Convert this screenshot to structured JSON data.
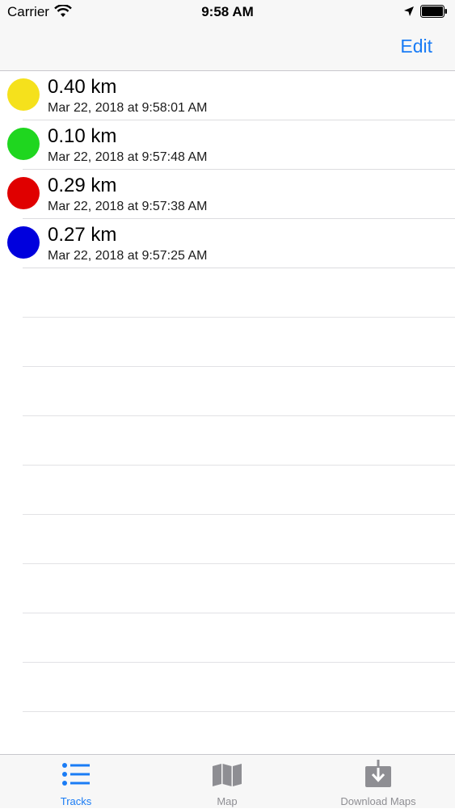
{
  "status_bar": {
    "carrier": "Carrier",
    "time": "9:58 AM",
    "wifi_icon": "wifi-icon",
    "location_icon": "location-arrow-icon",
    "battery_icon": "battery-icon"
  },
  "nav": {
    "edit_label": "Edit",
    "accent_color": "#1a7cf5"
  },
  "tracks": [
    {
      "distance": "0.40 km",
      "date": "Mar 22, 2018 at 9:58:01 AM",
      "color": "#f5e11c"
    },
    {
      "distance": "0.10 km",
      "date": "Mar 22, 2018 at 9:57:48 AM",
      "color": "#1fd61f"
    },
    {
      "distance": "0.29 km",
      "date": "Mar 22, 2018 at 9:57:38 AM",
      "color": "#e00000"
    },
    {
      "distance": "0.27 km",
      "date": "Mar 22, 2018 at 9:57:25 AM",
      "color": "#0000dd"
    }
  ],
  "tabbar": {
    "tabs": [
      {
        "label": "Tracks",
        "icon": "list-icon",
        "selected": true
      },
      {
        "label": "Map",
        "icon": "map-icon",
        "selected": false
      },
      {
        "label": "Download Maps",
        "icon": "download-icon",
        "selected": false
      }
    ]
  }
}
